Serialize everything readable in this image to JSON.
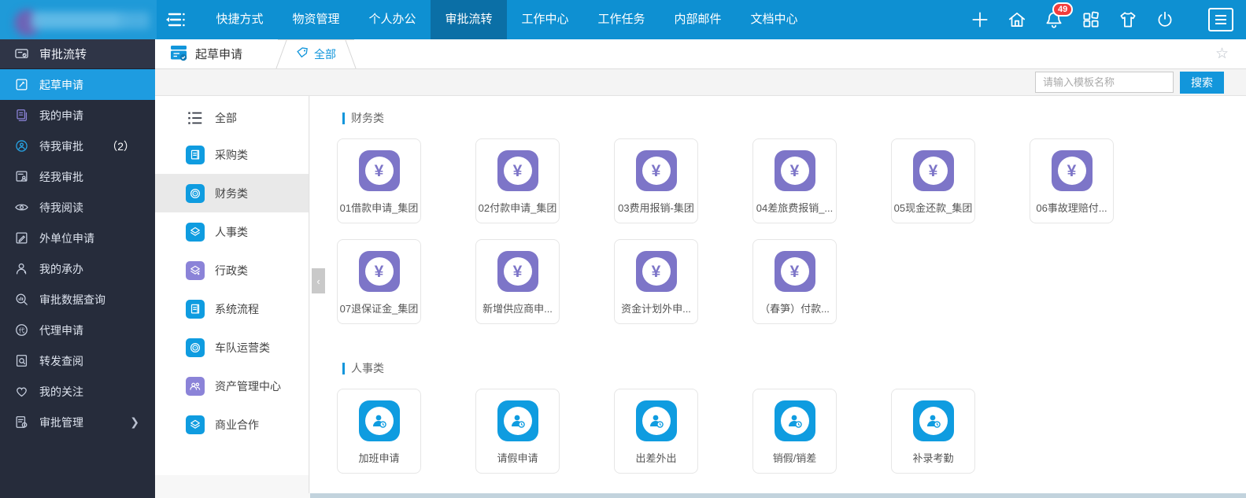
{
  "colors": {
    "accent": "#1296db",
    "purple": "#7d75c8",
    "blue": "#0f9ce0",
    "topbar": "#0e90d2",
    "active_nav": "#0b6fa6",
    "sidebar": "#262c3b",
    "badge": "#f23c3c"
  },
  "topbar": {
    "nav_toggle_icon": "menu-collapse-icon",
    "nav": [
      {
        "label": "快捷方式",
        "active": false
      },
      {
        "label": "物资管理",
        "active": false
      },
      {
        "label": "个人办公",
        "active": false
      },
      {
        "label": "审批流转",
        "active": true
      },
      {
        "label": "工作中心",
        "active": false
      },
      {
        "label": "工作任务",
        "active": false
      },
      {
        "label": "内部邮件",
        "active": false
      },
      {
        "label": "文档中心",
        "active": false
      }
    ],
    "right_icons": [
      {
        "name": "plus"
      },
      {
        "name": "home"
      },
      {
        "name": "bell",
        "badge": "49"
      },
      {
        "name": "apps"
      },
      {
        "name": "shirt"
      },
      {
        "name": "power"
      }
    ]
  },
  "sidebar": {
    "header": "审批流转",
    "items": [
      {
        "label": "起草申请",
        "icon": "edit-square",
        "active": true
      },
      {
        "label": "我的申请",
        "icon": "docs",
        "icon_color": "#8b83d8"
      },
      {
        "label": "待我审批",
        "icon": "clock-person",
        "icon_color": "#27a6e8",
        "count": "（2）"
      },
      {
        "label": "经我审批",
        "icon": "doc-person"
      },
      {
        "label": "待我阅读",
        "icon": "eye"
      },
      {
        "label": "外单位申请",
        "icon": "doc-pen"
      },
      {
        "label": "我的承办",
        "icon": "person"
      },
      {
        "label": "审批数据查询",
        "icon": "search-chart"
      },
      {
        "label": "代理申请",
        "icon": "agent-circle"
      },
      {
        "label": "转发查阅",
        "icon": "doc-search"
      },
      {
        "label": "我的关注",
        "icon": "heart"
      },
      {
        "label": "审批管理",
        "icon": "doc-gear",
        "expandable": true
      }
    ]
  },
  "tabs": {
    "primary": "起草申请",
    "active_tab": "全部",
    "favorite_icon": "star"
  },
  "search": {
    "placeholder": "请输入模板名称",
    "button": "搜索"
  },
  "categories": [
    {
      "label": "全部",
      "icon": "list",
      "style": "plain",
      "selected": false
    },
    {
      "label": "采购类",
      "icon": "doc-lines",
      "tile": "#0f9ce0",
      "selected": false
    },
    {
      "label": "财务类",
      "icon": "fingerprint",
      "tile": "#0f9ce0",
      "selected": true
    },
    {
      "label": "人事类",
      "icon": "layers",
      "tile": "#0f9ce0",
      "selected": false
    },
    {
      "label": "行政类",
      "icon": "layers-star",
      "tile": "#8b83d8",
      "selected": false
    },
    {
      "label": "系统流程",
      "icon": "doc-lines",
      "tile": "#0f9ce0",
      "selected": false
    },
    {
      "label": "车队运营类",
      "icon": "fingerprint",
      "tile": "#0f9ce0",
      "selected": false
    },
    {
      "label": "资产管理中心",
      "icon": "people",
      "tile": "#8b83d8",
      "selected": false
    },
    {
      "label": "商业合作",
      "icon": "layers",
      "tile": "#0f9ce0",
      "selected": false
    }
  ],
  "collapse_handle": "‹",
  "sections": [
    {
      "title": "财务类",
      "tile_color": "#7d75c8",
      "glyph": "yuan",
      "items": [
        "01借款申请_集团",
        "02付款申请_集团",
        "03费用报销-集团",
        "04差旅费报销_...",
        "05现金还款_集团",
        "06事故理赔付...",
        "07退保证金_集团",
        "新增供应商申...",
        "资金计划外申...",
        "（春笋）付款..."
      ]
    },
    {
      "title": "人事类",
      "tile_color": "#0f9ce0",
      "glyph": "person-clock",
      "items": [
        "加班申请",
        "请假申请",
        "出差外出",
        "销假/销差",
        "补录考勤"
      ]
    }
  ]
}
